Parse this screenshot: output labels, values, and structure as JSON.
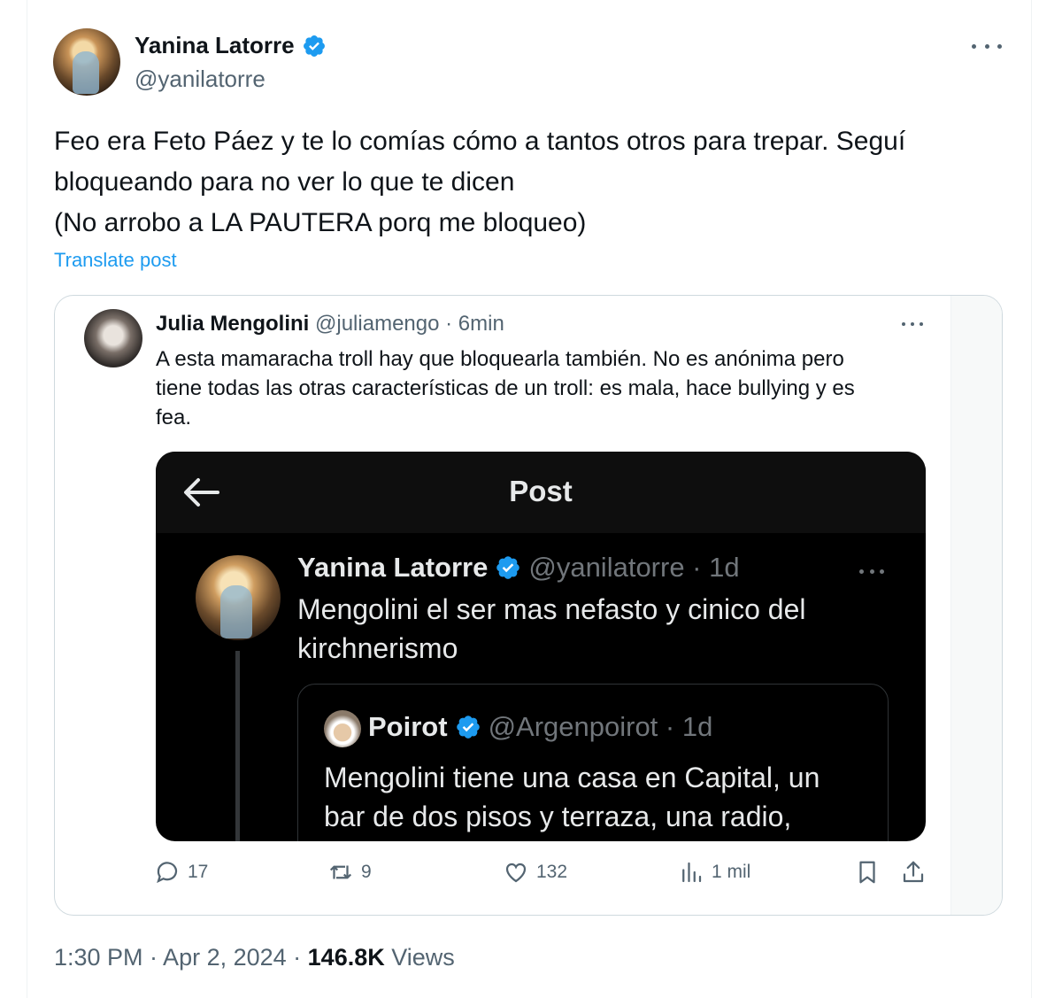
{
  "author": {
    "name": "Yanina Latorre",
    "handle": "@yanilatorre",
    "verified": true
  },
  "tweet": {
    "lines": [
      "Feo era Feto Páez y te lo comías cómo a tantos otros para trepar. Seguí",
      "bloqueando para no ver lo que te dicen",
      "(No arrobo a LA PAUTERA porq me bloqueo)"
    ],
    "translate_label": "Translate post"
  },
  "quoted": {
    "name": "Julia Mengolini",
    "meta": "@juliamengo · 6min",
    "lines": [
      "A esta mamaracha troll hay que bloquearla también. No es anónima pero",
      "tiene todas las otras características de un troll: es mala, hace bullying y es",
      "fea."
    ],
    "embedded": {
      "header_title": "Post",
      "author_name": "Yanina Latorre",
      "author_meta": "@yanilatorre · 1d",
      "lines": [
        "Mengolini el ser mas nefasto y cinico del",
        "kirchnerismo"
      ],
      "inner": {
        "name": "Poirot",
        "meta": "@Argenpoirot · 1d",
        "lines": [
          "Mengolini tiene una casa en Capital, un",
          "bar de dos pisos y terraza, una radio,"
        ]
      }
    },
    "actions": {
      "replies": "17",
      "reposts": "9",
      "likes": "132",
      "views": "1 mil"
    }
  },
  "footer": {
    "time": "1:30 PM · Apr 2, 2024 · ",
    "views_count": "146.8K",
    "views_label": " Views"
  },
  "colors": {
    "accent": "#1d9bf0",
    "text": "#0f1419",
    "muted": "#536471",
    "dark_bg": "#000000"
  },
  "icons": [
    "verified-icon",
    "more-icon",
    "back-arrow-icon",
    "reply-icon",
    "repost-icon",
    "like-icon",
    "views-icon",
    "bookmark-icon",
    "share-icon"
  ]
}
